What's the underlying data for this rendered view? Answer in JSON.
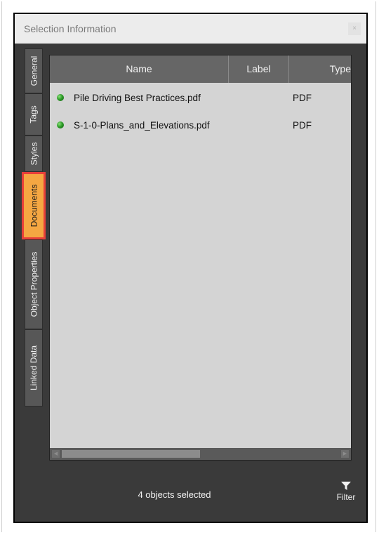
{
  "window": {
    "title": "Selection Information",
    "close_glyph": "×"
  },
  "tabs": [
    {
      "label": "General",
      "active": false
    },
    {
      "label": "Tags",
      "active": false
    },
    {
      "label": "Styles",
      "active": false
    },
    {
      "label": "Documents",
      "active": true
    },
    {
      "label": "Object Properties",
      "active": false
    },
    {
      "label": "Linked Data",
      "active": false
    }
  ],
  "grid": {
    "columns": [
      "Name",
      "Label",
      "Type"
    ],
    "rows": [
      {
        "status_icon": "green-status-dot-icon",
        "name": "Pile Driving Best Practices.pdf",
        "label": "",
        "type": "PDF"
      },
      {
        "status_icon": "green-status-dot-icon",
        "name": "S-1-0-Plans_and_Elevations.pdf",
        "label": "",
        "type": "PDF"
      }
    ]
  },
  "status": {
    "text": "4 objects selected"
  },
  "filter": {
    "label": "Filter",
    "icon": "filter-funnel-icon"
  },
  "colors": {
    "window_bg": "#3a3a3a",
    "panel_bg": "#d4d4d4",
    "active_tab": "#f5a742",
    "highlight_border": "#e8403a",
    "status_dot": "#2f9d2a"
  }
}
